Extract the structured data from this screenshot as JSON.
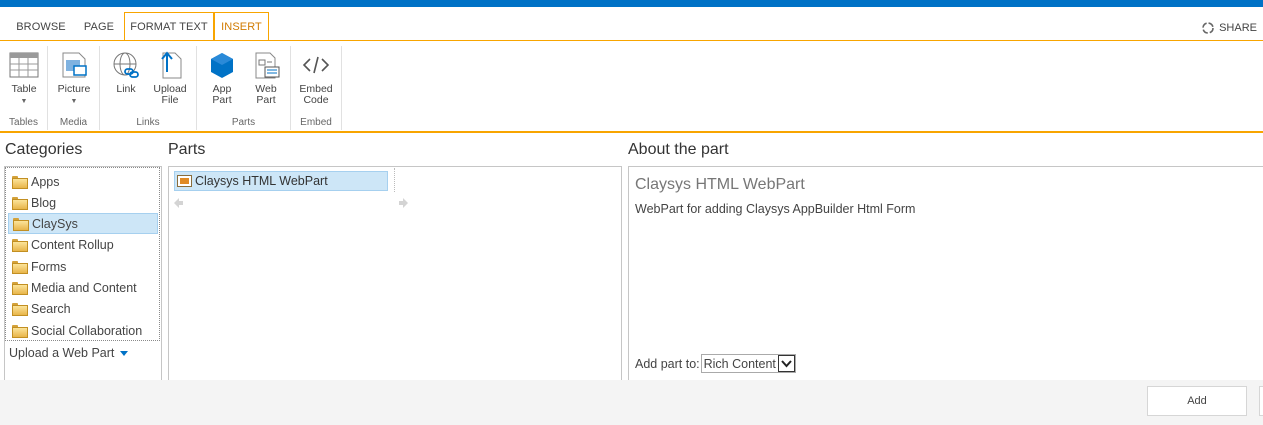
{
  "ribbon_tabs": {
    "browse": "BROWSE",
    "page": "PAGE",
    "format_text": "FORMAT TEXT",
    "insert": "INSERT"
  },
  "share_label": "SHARE",
  "ribbon": {
    "table": "Table",
    "picture": "Picture",
    "link": "Link",
    "upload_file_1": "Upload",
    "upload_file_2": "File",
    "app_part_1": "App",
    "app_part_2": "Part",
    "web_part_1": "Web",
    "web_part_2": "Part",
    "embed_code_1": "Embed",
    "embed_code_2": "Code",
    "groups": {
      "tables": "Tables",
      "media": "Media",
      "links": "Links",
      "parts": "Parts",
      "embed": "Embed"
    }
  },
  "categories": {
    "title": "Categories",
    "items": [
      "Apps",
      "Blog",
      "ClaySys",
      "Content Rollup",
      "Forms",
      "Media and Content",
      "Search",
      "Social Collaboration"
    ],
    "selected": "ClaySys",
    "upload_link": "Upload a Web Part"
  },
  "parts": {
    "title": "Parts",
    "items": [
      "Claysys HTML WebPart"
    ]
  },
  "about": {
    "title": "About the part",
    "part_name": "Claysys HTML WebPart",
    "description": "WebPart for adding Claysys AppBuilder Html Form",
    "add_part_to_label": "Add part to:",
    "add_part_to_value": "Rich Content"
  },
  "footer": {
    "add_button": "Add"
  },
  "colors": {
    "suite_bar": "#0072c6",
    "contextual_tab": "#f8a500",
    "selection": "#cde6f7"
  }
}
